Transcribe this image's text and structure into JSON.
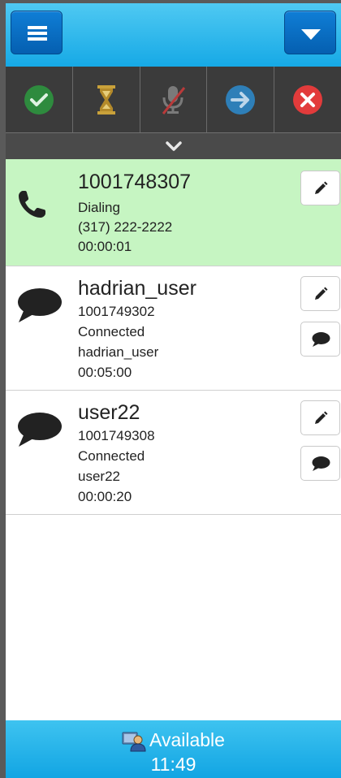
{
  "header": {
    "menu_icon": "hamburger-icon",
    "dropdown_icon": "caret-down-icon"
  },
  "toolbar": {
    "buttons": [
      {
        "icon": "check-circle-icon",
        "color": "#2e8b3e"
      },
      {
        "icon": "hourglass-icon",
        "color": "#c9a13a"
      },
      {
        "icon": "microphone-muted-icon",
        "color": "#7a7a7a"
      },
      {
        "icon": "arrow-right-circle-icon",
        "color": "#2e7fb8"
      },
      {
        "icon": "close-circle-icon",
        "color": "#e23b3b"
      }
    ],
    "expand_icon": "chevron-down-icon"
  },
  "items": [
    {
      "type": "phone",
      "title": "1001748307",
      "lines": [
        "Dialing",
        "(317) 222-2222",
        "00:00:01"
      ],
      "active": true
    },
    {
      "type": "chat",
      "title": "hadrian_user",
      "lines": [
        "1001749302",
        "Connected",
        "hadrian_user",
        "00:05:00"
      ],
      "active": false
    },
    {
      "type": "chat",
      "title": "user22",
      "lines": [
        "1001749308",
        "Connected",
        "user22",
        "00:00:20"
      ],
      "active": false
    }
  ],
  "footer": {
    "status": "Available",
    "timer": "11:49",
    "status_icon": "agent-status-icon"
  },
  "colors": {
    "header_blue": "#16a9e6",
    "button_blue": "#055fb0",
    "toolbar_dark": "#3b3b3b",
    "active_green": "#c6f5c2"
  }
}
